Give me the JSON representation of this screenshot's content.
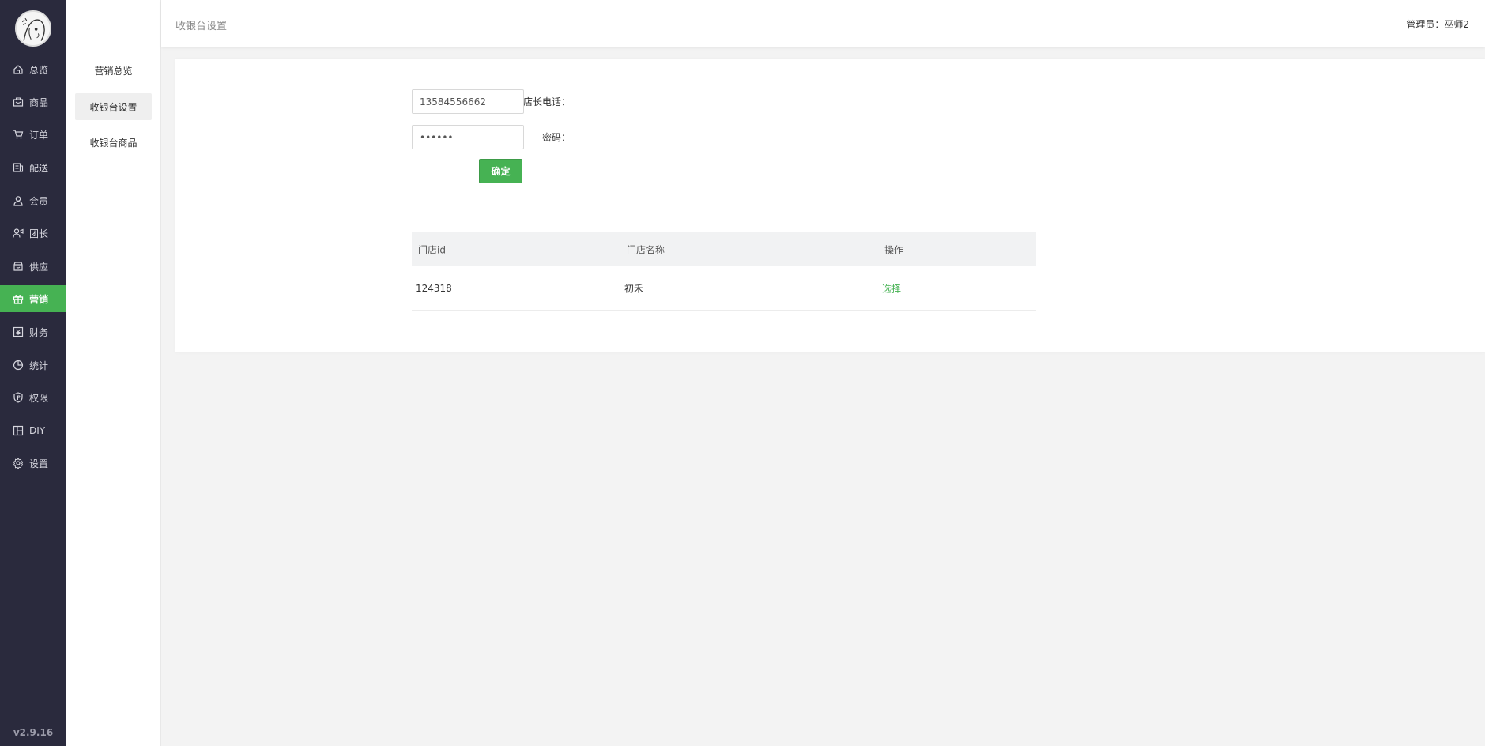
{
  "app": {
    "version": "v2.9.16",
    "accent_color": "#46b253",
    "sidebar_bg": "#2a2a3d"
  },
  "sidebar": {
    "items": [
      {
        "label": "总览",
        "icon": "home-icon"
      },
      {
        "label": "商品",
        "icon": "goods-icon"
      },
      {
        "label": "订单",
        "icon": "order-icon"
      },
      {
        "label": "配送",
        "icon": "delivery-icon"
      },
      {
        "label": "会员",
        "icon": "member-icon"
      },
      {
        "label": "团长",
        "icon": "leader-icon"
      },
      {
        "label": "供应",
        "icon": "supply-icon"
      },
      {
        "label": "营销",
        "icon": "gift-icon",
        "active": true
      },
      {
        "label": "财务",
        "icon": "finance-icon"
      },
      {
        "label": "统计",
        "icon": "pie-chart-icon"
      },
      {
        "label": "权限",
        "icon": "shield-icon"
      },
      {
        "label": "DIY",
        "icon": "layout-icon"
      },
      {
        "label": "设置",
        "icon": "gear-icon"
      }
    ]
  },
  "submenu": {
    "items": [
      {
        "label": "营销总览"
      },
      {
        "label": "收银台设置",
        "active": true
      },
      {
        "label": "收银台商品"
      }
    ]
  },
  "header": {
    "title": "收银台设置",
    "admin_label": "管理员：",
    "admin_name": "巫师2"
  },
  "form": {
    "phone_label": "店长电话：",
    "phone_value": "13584556662",
    "password_label": "密码：",
    "password_value": "••••••",
    "confirm_label": "确定"
  },
  "table": {
    "columns": [
      "门店id",
      "门店名称",
      "操作"
    ],
    "rows": [
      {
        "id": "124318",
        "name": "初禾",
        "action": "选择"
      }
    ]
  }
}
